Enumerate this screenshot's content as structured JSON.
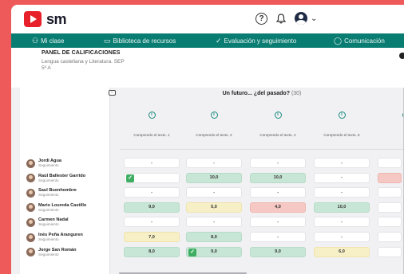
{
  "app": {
    "logo_text": "sm",
    "icons": {
      "help": "help-icon",
      "bell": "bell-icon",
      "avatar": "user-avatar-icon",
      "chevron": "chevron-down-icon"
    }
  },
  "nav": {
    "items": [
      {
        "label": "Mi clase",
        "icon": "people-icon"
      },
      {
        "label": "Biblioteca de recursos",
        "icon": "folder-icon"
      },
      {
        "label": "Evaluación y seguimiento",
        "icon": "check-icon"
      },
      {
        "label": "Comunicación",
        "icon": "chat-icon"
      }
    ]
  },
  "header": {
    "title": "PANEL DE CALIFICACIONES",
    "subject": "Lengua castellana y Literatura. SEP",
    "group": "5º A"
  },
  "activity": {
    "title": "Un futuro... ¿del pasado?",
    "count": "(30)"
  },
  "columns": [
    "Comprendo el texto. 1",
    "Comprendo el texto. 2",
    "Comprendo el texto. 4",
    "Comprendo el texto. 5",
    "Co"
  ],
  "students": [
    {
      "name": "Jordi Agua",
      "status": "Seguimiento",
      "grades": [
        {
          "v": "-",
          "c": "white"
        },
        {
          "v": "-",
          "c": "white"
        },
        {
          "v": "-",
          "c": "white"
        },
        {
          "v": "-",
          "c": "white"
        },
        {
          "v": "",
          "c": "white"
        }
      ]
    },
    {
      "name": "Raúl Ballester Garrido",
      "status": "Seguimiento",
      "grades": [
        {
          "v": "",
          "c": "white",
          "check": true
        },
        {
          "v": "10,0",
          "c": "green"
        },
        {
          "v": "10,0",
          "c": "green"
        },
        {
          "v": "-",
          "c": "white"
        },
        {
          "v": "",
          "c": "red"
        }
      ]
    },
    {
      "name": "Saul Buenhombre",
      "status": "Seguimiento",
      "grades": [
        {
          "v": "-",
          "c": "white"
        },
        {
          "v": "-",
          "c": "white"
        },
        {
          "v": "-",
          "c": "white"
        },
        {
          "v": "-",
          "c": "white"
        },
        {
          "v": "",
          "c": "white"
        }
      ]
    },
    {
      "name": "Mario Loureda Castillo",
      "status": "Seguimiento",
      "grades": [
        {
          "v": "9,0",
          "c": "green"
        },
        {
          "v": "5,0",
          "c": "yellow"
        },
        {
          "v": "4,0",
          "c": "red"
        },
        {
          "v": "10,0",
          "c": "green"
        },
        {
          "v": "",
          "c": "white"
        }
      ]
    },
    {
      "name": "Carmen Nadal",
      "status": "Seguimiento",
      "grades": [
        {
          "v": "-",
          "c": "white"
        },
        {
          "v": "-",
          "c": "white"
        },
        {
          "v": "-",
          "c": "white"
        },
        {
          "v": "-",
          "c": "white"
        },
        {
          "v": "",
          "c": "white"
        }
      ]
    },
    {
      "name": "Inés Peña Aranguren",
      "status": "Seguimiento",
      "grades": [
        {
          "v": "7,0",
          "c": "yellow"
        },
        {
          "v": "8,0",
          "c": "green"
        },
        {
          "v": "-",
          "c": "white"
        },
        {
          "v": "-",
          "c": "white"
        },
        {
          "v": "",
          "c": "white"
        }
      ]
    },
    {
      "name": "Jorge San Román",
      "status": "Seguimiento",
      "grades": [
        {
          "v": "8,0",
          "c": "green"
        },
        {
          "v": "9,0",
          "c": "green",
          "check": true
        },
        {
          "v": "9,0",
          "c": "green"
        },
        {
          "v": "6,0",
          "c": "yellow"
        },
        {
          "v": "",
          "c": "white"
        }
      ]
    }
  ],
  "colors": {
    "brand_red": "#e8202a",
    "nav_teal": "#0a7d72",
    "background": "#ee5a5a"
  }
}
